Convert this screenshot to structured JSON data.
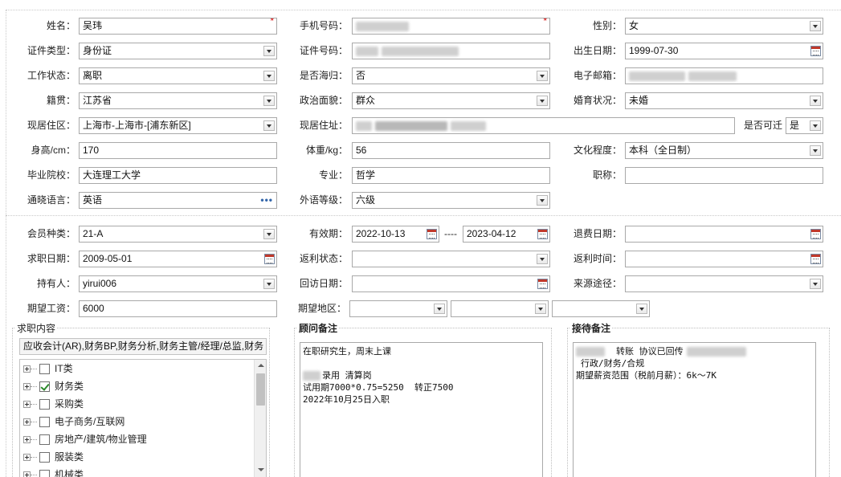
{
  "form": {
    "name": {
      "label": "姓名：",
      "value": "吴玮",
      "required": "*"
    },
    "mobile": {
      "label": "手机号码：",
      "value": "",
      "required": "*"
    },
    "gender": {
      "label": "性别：",
      "value": "女"
    },
    "id_type": {
      "label": "证件类型：",
      "value": "身份证"
    },
    "id_number": {
      "label": "证件号码：",
      "value": ""
    },
    "birth_date": {
      "label": "出生日期：",
      "value": "1999-07-30"
    },
    "work_status": {
      "label": "工作状态：",
      "value": "离职"
    },
    "returnee": {
      "label": "是否海归：",
      "value": "否"
    },
    "email": {
      "label": "电子邮箱：",
      "value": ""
    },
    "native_place": {
      "label": "籍贯：",
      "value": "江苏省"
    },
    "political": {
      "label": "政治面貌：",
      "value": "群众"
    },
    "marital": {
      "label": "婚育状况：",
      "value": "未婚"
    },
    "residence_area": {
      "label": "现居住区：",
      "value": "上海市-上海市-[浦东新区]"
    },
    "residence_addr": {
      "label": "现居住址：",
      "value": ""
    },
    "transfer": {
      "label": "是否可迁",
      "value": "是"
    },
    "height": {
      "label": "身高/cm：",
      "value": "170"
    },
    "weight": {
      "label": "体重/kg：",
      "value": "56"
    },
    "education": {
      "label": "文化程度：",
      "value": "本科（全日制）"
    },
    "school": {
      "label": "毕业院校：",
      "value": "大连理工大学"
    },
    "major": {
      "label": "专业：",
      "value": "哲学"
    },
    "title": {
      "label": "职称：",
      "value": ""
    },
    "language": {
      "label": "通晓语言：",
      "value": "英语",
      "more": "•••"
    },
    "foreign_level": {
      "label": "外语等级：",
      "value": "六级"
    },
    "member_type": {
      "label": "会员种类：",
      "value": "21-A"
    },
    "valid_period": {
      "label": "有效期：",
      "start": "2022-10-13",
      "sep": "----",
      "end": "2023-04-12"
    },
    "refund_date": {
      "label": "退费日期：",
      "value": ""
    },
    "job_date": {
      "label": "求职日期：",
      "value": "2009-05-01"
    },
    "rebate_status": {
      "label": "返利状态：",
      "value": ""
    },
    "rebate_time": {
      "label": "返利时间：",
      "value": ""
    },
    "holder": {
      "label": "持有人：",
      "value": "yirui006"
    },
    "revisit_date": {
      "label": "回访日期：",
      "value": ""
    },
    "source": {
      "label": "来源途径：",
      "value": ""
    },
    "expected_salary": {
      "label": "期望工资：",
      "value": "6000"
    },
    "expected_area": {
      "label": "期望地区：",
      "v1": "",
      "v2": "",
      "v3": ""
    }
  },
  "job_content": {
    "title": "求职内容",
    "selected": "应收会计(AR),财务BP,财务分析,财务主管/经理/总监,财务",
    "tree": [
      {
        "label": "IT类",
        "checked": false
      },
      {
        "label": "财务类",
        "checked": true
      },
      {
        "label": "采购类",
        "checked": false
      },
      {
        "label": "电子商务/互联网",
        "checked": false
      },
      {
        "label": "房地产/建筑/物业管理",
        "checked": false
      },
      {
        "label": "服装类",
        "checked": false
      },
      {
        "label": "机械类",
        "checked": false
      }
    ]
  },
  "consultant_notes": {
    "title": "顾问备注",
    "lines": [
      "在职研究生，周末上课",
      "",
      "录用 清算岗",
      "试用期7000*0.75=5250  转正7500",
      "2022年10月25日入职"
    ]
  },
  "reception_notes": {
    "title": "接待备注",
    "lines": [
      "转账 协议已回传",
      "行政/财务/合规",
      "期望薪资范围（税前月薪）：6k～7K"
    ]
  },
  "icons": {
    "dropdown": "chevron-down-icon",
    "calendar": "calendar-icon",
    "more": "ellipsis-icon",
    "expand": "plus-icon",
    "checkbox": "checkbox-icon"
  },
  "colors": {
    "required": "#d60000",
    "border": "#a9a9a9",
    "check": "#2b8a2b"
  }
}
